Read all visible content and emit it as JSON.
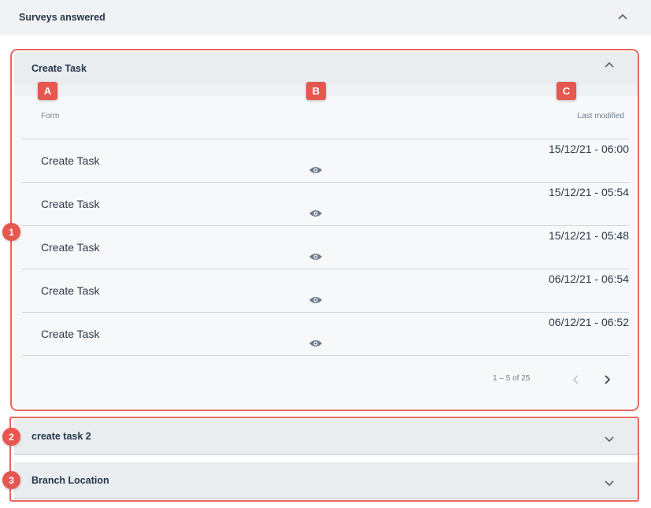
{
  "header": {
    "title": "Surveys answered"
  },
  "panels": [
    {
      "title": "Create Task",
      "expanded": true,
      "table": {
        "columns": {
          "form": "Form",
          "last_modified": "Last modified"
        },
        "rows": [
          {
            "form": "Create Task",
            "last_modified": "15/12/21 - 06:00",
            "action_icon": "eye-icon"
          },
          {
            "form": "Create Task",
            "last_modified": "15/12/21 - 05:54",
            "action_icon": "eye-icon"
          },
          {
            "form": "Create Task",
            "last_modified": "15/12/21 - 05:48",
            "action_icon": "eye-icon"
          },
          {
            "form": "Create Task",
            "last_modified": "06/12/21 - 06:54",
            "action_icon": "eye-icon"
          },
          {
            "form": "Create Task",
            "last_modified": "06/12/21 - 06:52",
            "action_icon": "eye-icon"
          }
        ],
        "pagination": {
          "range": "1 – 5 of 25",
          "prev_icon": "chevron-left-icon",
          "next_icon": "chevron-right-icon"
        }
      }
    },
    {
      "title": "create task 2",
      "expanded": false
    },
    {
      "title": "Branch Location",
      "expanded": false
    }
  ],
  "annotations": {
    "columns": [
      "A",
      "B",
      "C"
    ],
    "panels": [
      "1",
      "2",
      "3"
    ]
  },
  "colors": {
    "annotation_red": "#e5574f",
    "header_bg": "#f0f2f4",
    "panel_bg": "#e9edf0",
    "text": "#2c3a4a",
    "muted_text": "#6f7d8c"
  }
}
